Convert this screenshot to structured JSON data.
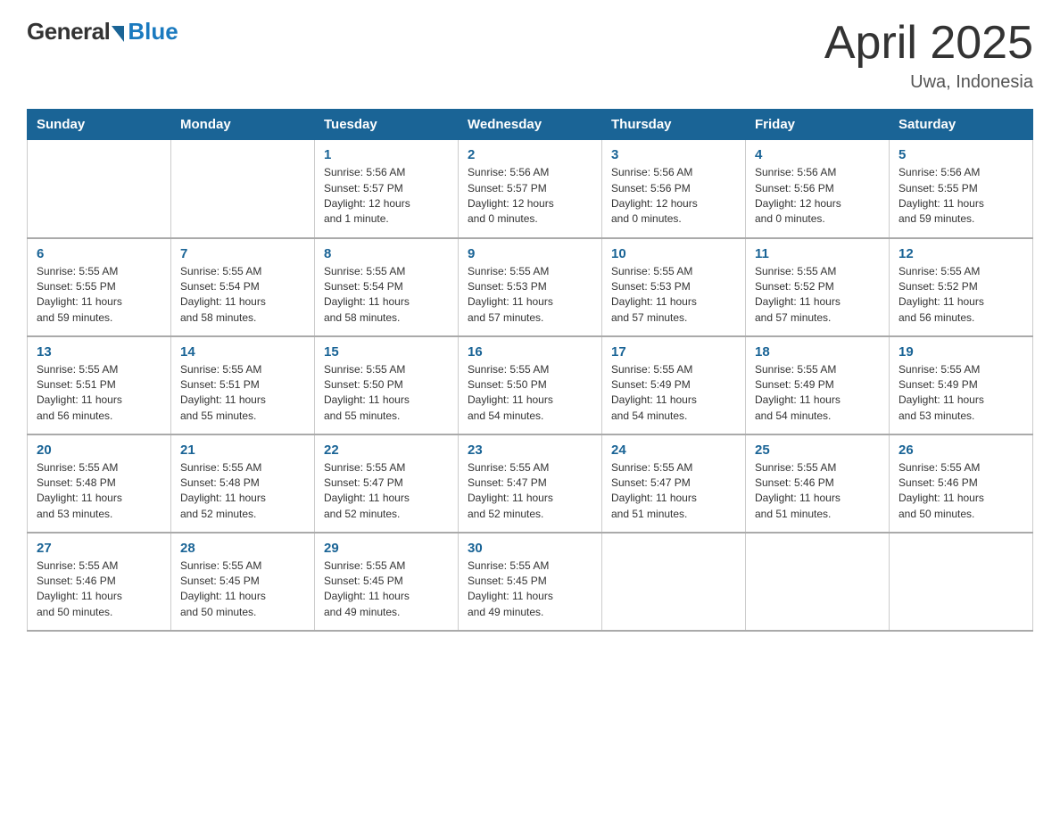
{
  "header": {
    "logo_general": "General",
    "logo_blue": "Blue",
    "title": "April 2025",
    "subtitle": "Uwa, Indonesia"
  },
  "days_of_week": [
    "Sunday",
    "Monday",
    "Tuesday",
    "Wednesday",
    "Thursday",
    "Friday",
    "Saturday"
  ],
  "weeks": [
    [
      {
        "day": "",
        "info": ""
      },
      {
        "day": "",
        "info": ""
      },
      {
        "day": "1",
        "info": "Sunrise: 5:56 AM\nSunset: 5:57 PM\nDaylight: 12 hours\nand 1 minute."
      },
      {
        "day": "2",
        "info": "Sunrise: 5:56 AM\nSunset: 5:57 PM\nDaylight: 12 hours\nand 0 minutes."
      },
      {
        "day": "3",
        "info": "Sunrise: 5:56 AM\nSunset: 5:56 PM\nDaylight: 12 hours\nand 0 minutes."
      },
      {
        "day": "4",
        "info": "Sunrise: 5:56 AM\nSunset: 5:56 PM\nDaylight: 12 hours\nand 0 minutes."
      },
      {
        "day": "5",
        "info": "Sunrise: 5:56 AM\nSunset: 5:55 PM\nDaylight: 11 hours\nand 59 minutes."
      }
    ],
    [
      {
        "day": "6",
        "info": "Sunrise: 5:55 AM\nSunset: 5:55 PM\nDaylight: 11 hours\nand 59 minutes."
      },
      {
        "day": "7",
        "info": "Sunrise: 5:55 AM\nSunset: 5:54 PM\nDaylight: 11 hours\nand 58 minutes."
      },
      {
        "day": "8",
        "info": "Sunrise: 5:55 AM\nSunset: 5:54 PM\nDaylight: 11 hours\nand 58 minutes."
      },
      {
        "day": "9",
        "info": "Sunrise: 5:55 AM\nSunset: 5:53 PM\nDaylight: 11 hours\nand 57 minutes."
      },
      {
        "day": "10",
        "info": "Sunrise: 5:55 AM\nSunset: 5:53 PM\nDaylight: 11 hours\nand 57 minutes."
      },
      {
        "day": "11",
        "info": "Sunrise: 5:55 AM\nSunset: 5:52 PM\nDaylight: 11 hours\nand 57 minutes."
      },
      {
        "day": "12",
        "info": "Sunrise: 5:55 AM\nSunset: 5:52 PM\nDaylight: 11 hours\nand 56 minutes."
      }
    ],
    [
      {
        "day": "13",
        "info": "Sunrise: 5:55 AM\nSunset: 5:51 PM\nDaylight: 11 hours\nand 56 minutes."
      },
      {
        "day": "14",
        "info": "Sunrise: 5:55 AM\nSunset: 5:51 PM\nDaylight: 11 hours\nand 55 minutes."
      },
      {
        "day": "15",
        "info": "Sunrise: 5:55 AM\nSunset: 5:50 PM\nDaylight: 11 hours\nand 55 minutes."
      },
      {
        "day": "16",
        "info": "Sunrise: 5:55 AM\nSunset: 5:50 PM\nDaylight: 11 hours\nand 54 minutes."
      },
      {
        "day": "17",
        "info": "Sunrise: 5:55 AM\nSunset: 5:49 PM\nDaylight: 11 hours\nand 54 minutes."
      },
      {
        "day": "18",
        "info": "Sunrise: 5:55 AM\nSunset: 5:49 PM\nDaylight: 11 hours\nand 54 minutes."
      },
      {
        "day": "19",
        "info": "Sunrise: 5:55 AM\nSunset: 5:49 PM\nDaylight: 11 hours\nand 53 minutes."
      }
    ],
    [
      {
        "day": "20",
        "info": "Sunrise: 5:55 AM\nSunset: 5:48 PM\nDaylight: 11 hours\nand 53 minutes."
      },
      {
        "day": "21",
        "info": "Sunrise: 5:55 AM\nSunset: 5:48 PM\nDaylight: 11 hours\nand 52 minutes."
      },
      {
        "day": "22",
        "info": "Sunrise: 5:55 AM\nSunset: 5:47 PM\nDaylight: 11 hours\nand 52 minutes."
      },
      {
        "day": "23",
        "info": "Sunrise: 5:55 AM\nSunset: 5:47 PM\nDaylight: 11 hours\nand 52 minutes."
      },
      {
        "day": "24",
        "info": "Sunrise: 5:55 AM\nSunset: 5:47 PM\nDaylight: 11 hours\nand 51 minutes."
      },
      {
        "day": "25",
        "info": "Sunrise: 5:55 AM\nSunset: 5:46 PM\nDaylight: 11 hours\nand 51 minutes."
      },
      {
        "day": "26",
        "info": "Sunrise: 5:55 AM\nSunset: 5:46 PM\nDaylight: 11 hours\nand 50 minutes."
      }
    ],
    [
      {
        "day": "27",
        "info": "Sunrise: 5:55 AM\nSunset: 5:46 PM\nDaylight: 11 hours\nand 50 minutes."
      },
      {
        "day": "28",
        "info": "Sunrise: 5:55 AM\nSunset: 5:45 PM\nDaylight: 11 hours\nand 50 minutes."
      },
      {
        "day": "29",
        "info": "Sunrise: 5:55 AM\nSunset: 5:45 PM\nDaylight: 11 hours\nand 49 minutes."
      },
      {
        "day": "30",
        "info": "Sunrise: 5:55 AM\nSunset: 5:45 PM\nDaylight: 11 hours\nand 49 minutes."
      },
      {
        "day": "",
        "info": ""
      },
      {
        "day": "",
        "info": ""
      },
      {
        "day": "",
        "info": ""
      }
    ]
  ]
}
